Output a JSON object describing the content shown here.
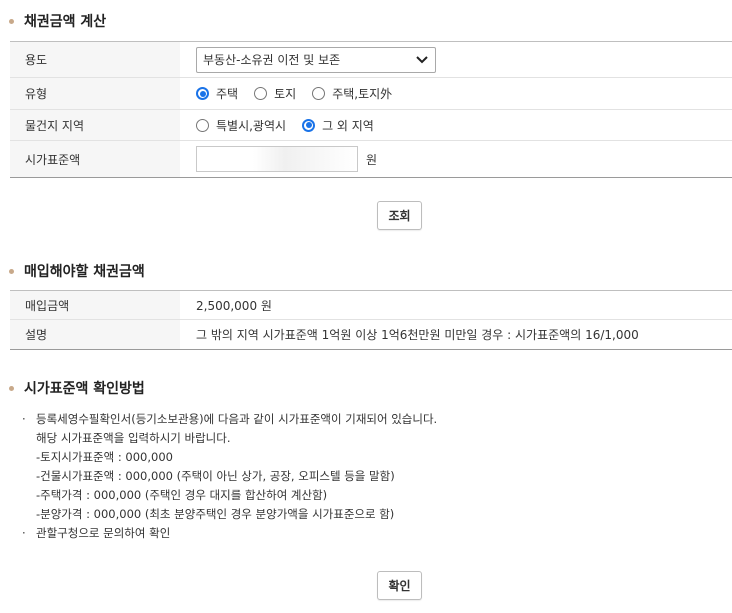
{
  "calc": {
    "title": "채권금액 계산",
    "rows": {
      "usage": {
        "label": "용도",
        "selected": "부동산-소유권 이전 및 보존"
      },
      "type": {
        "label": "유형",
        "options": [
          "주택",
          "토지",
          "주택,토지外"
        ],
        "selected_index": 0
      },
      "location": {
        "label": "물건지 지역",
        "options": [
          "특별시,광역시",
          "그 외 지역"
        ],
        "selected_index": 1
      },
      "price": {
        "label": "시가표준액",
        "value": "",
        "unit": "원"
      }
    },
    "query_button": "조회"
  },
  "result": {
    "title": "매입해야할 채권금액",
    "rows": {
      "amount": {
        "label": "매입금액",
        "value": "2,500,000 원"
      },
      "desc": {
        "label": "설명",
        "value": "그 밖의 지역 시가표준액 1억원 이상 1억6천만원 미만일 경우 : 시가표준액의 16/1,000"
      }
    }
  },
  "method": {
    "title": "시가표준액 확인방법",
    "bullets": {
      "first": "등록세영수필확인서(등기소보관용)에 다음과 같이 시가표준액이 기재되어 있습니다.",
      "sub": [
        "해당 시가표준액을 입력하시기 바랍니다.",
        "-토지시가표준액 : 000,000",
        "-건물시가표준액 : 000,000 (주택이 아닌 상가, 공장, 오피스텔 등을 말함)",
        "-주택가격 : 000,000 (주택인 경우 대지를 합산하여 계산함)",
        "-분양가격 : 000,000 (최초 분양주택인 경우 분양가액을 시가표준으로 함)"
      ],
      "second": "관할구청으로 문의하여 확인"
    },
    "confirm_button": "확인"
  }
}
